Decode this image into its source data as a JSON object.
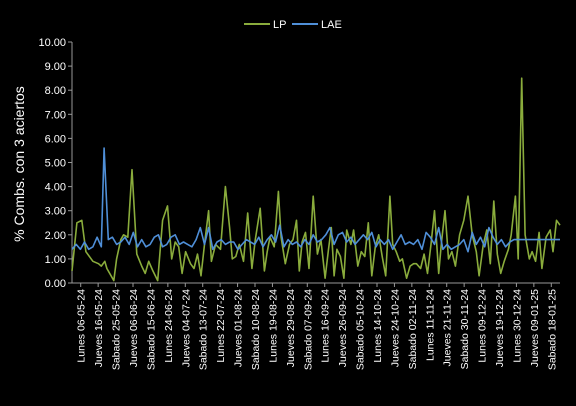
{
  "chart_data": {
    "type": "line",
    "title": "",
    "xlabel": "",
    "ylabel": "% Combs. con 3 aciertos",
    "ylim": [
      0,
      10
    ],
    "yticks": [
      "0.00",
      "1.00",
      "2.00",
      "3.00",
      "4.00",
      "5.00",
      "6.00",
      "7.00",
      "8.00",
      "9.00",
      "10.00"
    ],
    "grid": false,
    "legend_position": "top-center",
    "background": "#000000",
    "text_color": "#ffffff",
    "categories": [
      "Lunes 06-05-24",
      "Jueves 16-05-24",
      "Sabado 25-05-24",
      "Jueves 06-06-24",
      "Sabado 15-06-24",
      "Lunes 24-06-24",
      "Jueves 04-07-24",
      "Sabado 13-07-24",
      "Lunes 22-07-24",
      "Jueves 01-08-24",
      "Sabado 10-08-24",
      "Lunes 19-08-24",
      "Jueves 29-08-24",
      "Sabado 07-09-24",
      "Lunes 16-09-24",
      "Jueves 26-09-24",
      "Sabado 05-10-24",
      "Lunes 14-10-24",
      "Jueves 24-10-24",
      "Sabado 02-11-24",
      "Lunes 11-11-24",
      "Jueves 21-11-24",
      "Sabado 30-11-24",
      "Lunes 09-12-24",
      "Jueves 19-12-24",
      "Lunes 30-12-24",
      "Jueves 09-01-25",
      "Sabado 18-01-25"
    ],
    "series": [
      {
        "name": "LP",
        "color": "#8aac3c",
        "values": [
          0.5,
          2.5,
          2.6,
          1.3,
          0.9,
          0.8,
          0.7,
          0.9,
          0.6,
          0.1,
          1.0,
          1.8,
          2.0,
          1.9,
          4.7,
          1.2,
          0.7,
          0.4,
          0.9,
          0.5,
          0.1,
          2.6,
          3.2,
          1.0,
          1.7,
          1.5,
          0.4,
          1.3,
          0.8,
          0.6,
          1.2,
          0.3,
          1.6,
          3.0,
          0.9,
          1.6,
          1.4,
          4.0,
          2.3,
          1.0,
          1.1,
          1.6,
          0.9,
          2.9,
          0.6,
          1.8,
          3.1,
          0.5,
          1.3,
          1.9,
          1.5,
          3.8,
          1.9,
          0.8,
          1.6,
          1.8,
          2.6,
          0.5,
          1.7,
          2.1,
          0.6,
          3.6,
          1.2,
          1.8,
          0.2,
          1.4,
          2.3,
          0.3,
          1.4,
          1.1,
          0.2,
          2.2,
          1.6,
          2.2,
          0.7,
          1.3,
          1.1,
          2.5,
          0.3,
          1.5,
          2.0,
          1.1,
          0.3,
          3.6,
          1.6,
          1.3,
          0.9,
          1.0,
          0.2,
          0.7,
          0.8,
          0.8,
          0.6,
          1.2,
          0.4,
          1.6,
          3.0,
          0.4,
          1.7,
          3.0,
          1.0,
          1.3,
          0.7,
          2.0,
          2.6,
          3.6,
          2.0,
          1.3,
          0.3,
          1.6,
          2.2,
          0.8,
          3.4,
          1.2,
          0.4,
          0.9,
          1.4,
          2.0,
          3.6,
          1.0,
          8.5,
          2.0,
          1.0,
          1.3,
          0.9,
          2.1,
          0.6,
          1.9,
          2.2,
          1.3,
          2.6,
          2.4
        ],
        "x_indices": [
          0,
          0.7,
          1.4,
          2.0,
          3.0,
          3.8,
          4.2,
          4.7,
          5.0,
          6.0,
          6.4,
          7.0,
          7.4,
          8.0,
          8.6,
          9.3,
          10.0,
          10.5,
          11.0,
          11.6,
          12.3,
          13.0,
          13.7,
          14.3,
          14.8,
          15.3,
          15.8,
          16.3,
          17.0,
          17.5,
          18.0,
          18.5,
          19.0,
          19.6,
          20.0,
          20.6,
          21.3,
          22.0,
          22.6,
          23.0,
          23.5,
          24.0,
          24.6,
          25.2,
          25.8,
          26.3,
          27.0,
          27.6,
          28.0,
          28.4,
          29.0,
          29.6,
          30.0,
          30.6,
          31.2,
          31.7,
          32.2,
          32.6,
          33.0,
          33.5,
          34.0,
          34.6,
          35.2,
          35.7,
          36.3,
          36.8,
          37.2,
          37.6,
          38.0,
          38.5,
          39.0,
          39.4,
          40.0,
          40.4,
          41.0,
          41.5,
          42.0,
          42.5,
          43.0,
          43.5,
          44.0,
          44.5,
          45.0,
          45.6,
          46.0,
          46.5,
          47.0,
          47.4,
          48.0,
          48.5,
          49.0,
          49.4,
          50.0,
          50.5,
          51.0,
          51.5,
          52.0,
          52.6,
          53.0,
          53.5,
          54.0,
          54.5,
          55.0,
          55.6,
          56.2,
          56.8,
          57.4,
          58.0,
          58.4,
          59.0,
          59.5,
          60.0,
          60.5,
          61.0,
          61.5,
          62.0,
          62.6,
          63.0,
          63.6,
          64.0,
          64.5,
          65.0,
          65.6,
          66.0,
          66.5,
          67.0,
          67.4,
          68.0,
          68.6,
          69.0,
          69.5,
          70.0
        ]
      },
      {
        "name": "LAE",
        "color": "#4f8fd8",
        "values": [
          1.4,
          1.6,
          1.4,
          1.7,
          1.4,
          1.5,
          1.9,
          1.5,
          5.6,
          1.8,
          1.9,
          1.6,
          1.7,
          1.9,
          1.6,
          2.1,
          1.5,
          1.8,
          1.5,
          1.6,
          1.9,
          2.0,
          1.5,
          1.6,
          1.9,
          2.0,
          1.6,
          1.7,
          1.6,
          1.5,
          1.8,
          2.3,
          1.6,
          2.3,
          1.4,
          1.7,
          1.8,
          1.6,
          1.7,
          1.7,
          1.4,
          1.6,
          1.8,
          1.7,
          1.6,
          1.9,
          1.5,
          1.8,
          2.0,
          1.7,
          2.4,
          1.5,
          1.8,
          1.6,
          1.7,
          1.5,
          1.8,
          1.6,
          2.0,
          1.7,
          1.8,
          2.0,
          2.3,
          1.6,
          2.0,
          2.1,
          1.7,
          1.9,
          1.6,
          1.8,
          2.0,
          1.8,
          2.1,
          1.5,
          1.8,
          1.6,
          1.8,
          1.4,
          1.7,
          2.0,
          1.6,
          1.7,
          1.6,
          1.8,
          1.4,
          2.1,
          1.9,
          1.6,
          2.3,
          1.4,
          1.6,
          1.4,
          1.5,
          1.6,
          1.8,
          1.3,
          2.1,
          1.6,
          1.9,
          1.5,
          2.3,
          1.9,
          1.6,
          1.8,
          1.5,
          1.7,
          1.8,
          1.8,
          1.8
        ],
        "x_indices": [
          0,
          0.6,
          1.2,
          1.8,
          2.4,
          3.0,
          3.6,
          4.2,
          4.6,
          5.2,
          5.8,
          6.4,
          7.0,
          7.6,
          8.2,
          8.8,
          9.4,
          10.0,
          10.6,
          11.2,
          11.8,
          12.4,
          13.0,
          13.6,
          14.2,
          14.8,
          15.4,
          16.0,
          16.6,
          17.2,
          17.8,
          18.4,
          19.0,
          19.6,
          20.2,
          20.8,
          21.4,
          22.0,
          22.6,
          23.2,
          23.8,
          24.4,
          25.0,
          25.6,
          26.2,
          26.8,
          27.4,
          28.0,
          28.6,
          29.2,
          29.8,
          30.4,
          31.0,
          31.6,
          32.2,
          32.8,
          33.4,
          34.0,
          34.6,
          35.2,
          35.8,
          36.4,
          37.0,
          37.6,
          38.2,
          38.8,
          39.4,
          40.0,
          40.6,
          41.2,
          41.8,
          42.4,
          43.0,
          43.6,
          44.2,
          44.8,
          45.4,
          46.0,
          46.6,
          47.2,
          47.8,
          48.4,
          49.0,
          49.6,
          50.2,
          50.8,
          51.4,
          52.0,
          52.6,
          53.2,
          53.8,
          54.4,
          55.0,
          55.6,
          56.2,
          56.8,
          57.4,
          58.0,
          58.6,
          59.2,
          59.8,
          60.4,
          61.0,
          61.6,
          62.2,
          62.8,
          63.4,
          64.6,
          70.0
        ]
      }
    ]
  }
}
